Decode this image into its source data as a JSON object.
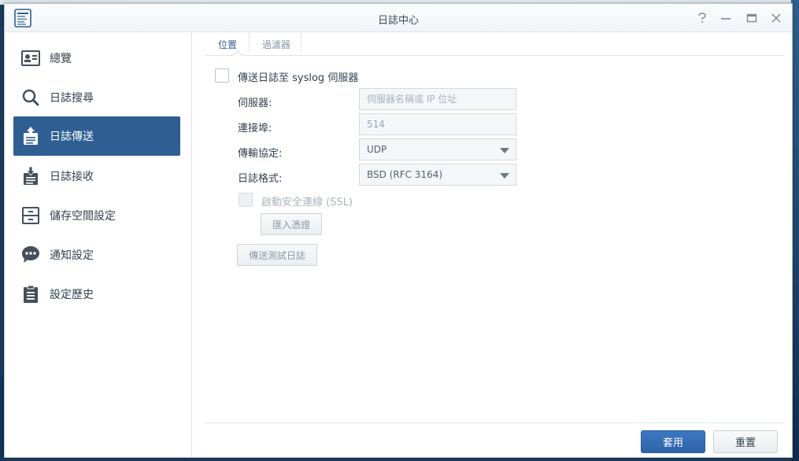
{
  "window": {
    "title": "日誌中心",
    "controls": {
      "help": "?",
      "minimize": "—",
      "maximize": "□",
      "close": "✕"
    }
  },
  "sidebar": {
    "items": [
      {
        "label": "總覽",
        "icon": "overview-icon",
        "active": false
      },
      {
        "label": "日誌搜尋",
        "icon": "search-icon",
        "active": false
      },
      {
        "label": "日誌傳送",
        "icon": "log-send-icon",
        "active": true
      },
      {
        "label": "日誌接收",
        "icon": "log-receive-icon",
        "active": false
      },
      {
        "label": "儲存空間設定",
        "icon": "storage-icon",
        "active": false
      },
      {
        "label": "通知設定",
        "icon": "notification-icon",
        "active": false
      },
      {
        "label": "設定歷史",
        "icon": "history-icon",
        "active": false
      }
    ]
  },
  "tabs": [
    {
      "label": "位置",
      "active": true
    },
    {
      "label": "過濾器",
      "active": false
    }
  ],
  "form": {
    "send_checkbox_label": "傳送日誌至 syslog 伺服器",
    "server_label": "伺服器:",
    "server_placeholder": "伺服器名稱或 IP 位址",
    "port_label": "連接埠:",
    "port_value": "514",
    "protocol_label": "傳輸協定:",
    "protocol_value": "UDP",
    "format_label": "日誌格式:",
    "format_value": "BSD (RFC 3164)",
    "ssl_label": "啟動安全連線 (SSL)",
    "import_cert_button": "匯入憑證",
    "send_test_button": "傳送測試日誌"
  },
  "footer": {
    "apply_button": "套用",
    "reset_button": "重置"
  },
  "colors": {
    "accent": "#2f5e92",
    "apply": "#3570b8"
  }
}
